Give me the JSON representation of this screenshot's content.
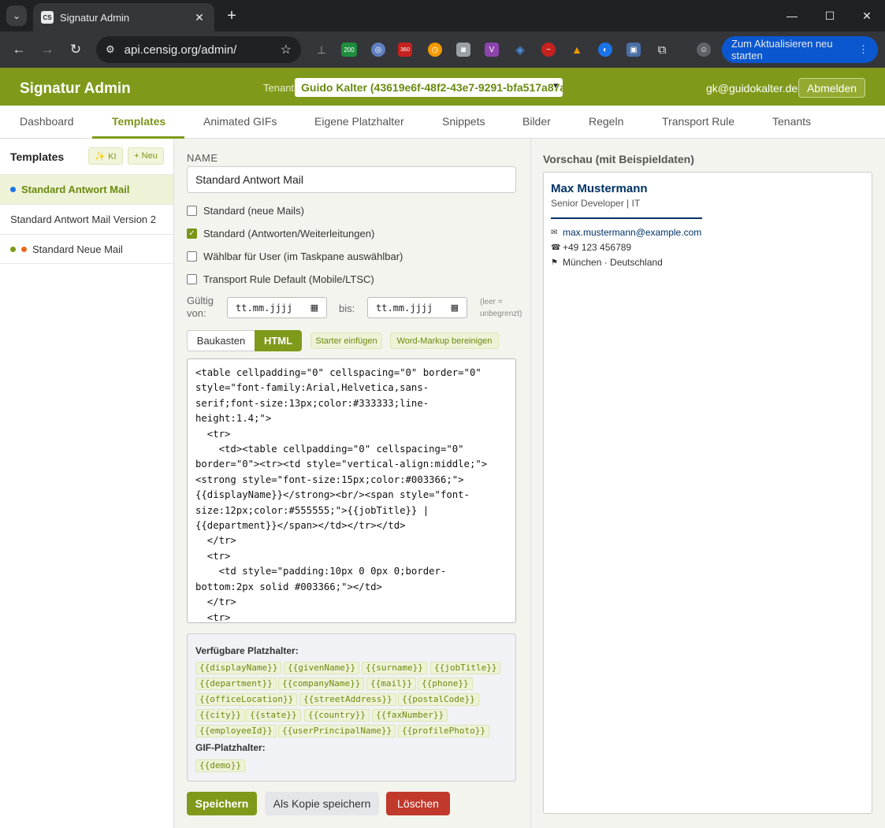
{
  "browser": {
    "tab_title": "Signatur Admin",
    "favicon": "CS",
    "url": "api.censig.org/admin/",
    "update_button": "Zum Aktualisieren neu starten",
    "extension_badge_1": "200",
    "extension_badge_2": "360"
  },
  "header": {
    "title": "Signatur Admin",
    "tenant_label": "Tenant",
    "tenant_value": "Guido Kalter (43619e6f-48f2-43e7-9291-bfa517a87ae",
    "user_email": "gk@guidokalter.de",
    "logout": "Abmelden",
    "accent_color": "#7f9a1a"
  },
  "nav": {
    "tabs": [
      "Dashboard",
      "Templates",
      "Animated GIFs",
      "Eigene Platzhalter",
      "Snippets",
      "Bilder",
      "Regeln",
      "Transport Rule",
      "Tenants"
    ],
    "active": "Templates"
  },
  "sidebar": {
    "title": "Templates",
    "ki_button": "✨ KI",
    "new_button": "+ Neu",
    "items": [
      {
        "label": "Standard Antwort Mail",
        "active": true
      },
      {
        "label": "Standard Antwort Mail Version 2",
        "active": false
      },
      {
        "label": "Standard Neue Mail",
        "active": false
      }
    ]
  },
  "editor": {
    "name_label": "NAME",
    "name_value": "Standard Antwort Mail",
    "checkboxes": [
      {
        "label": "Standard (neue Mails)",
        "checked": false
      },
      {
        "label": "Standard (Antworten/Weiterleitungen)",
        "checked": true
      },
      {
        "label": "Wählbar für User (im Taskpane auswählbar)",
        "checked": false
      },
      {
        "label": "Transport Rule Default (Mobile/LTSC)",
        "checked": false
      }
    ],
    "valid_from_label": "Gültig von:",
    "valid_to_label": "bis:",
    "date_placeholder": "tt.mm.jjjj",
    "hint": "(leer = unbegrenzt)",
    "mode_builder": "Baukasten",
    "mode_html": "HTML",
    "starter_button": "Starter einfügen",
    "clean_button": "Word-Markup bereinigen",
    "code": "<table cellpadding=\"0\" cellspacing=\"0\" border=\"0\"\nstyle=\"font-family:Arial,Helvetica,sans-\nserif;font-size:13px;color:#333333;line-\nheight:1.4;\">\n  <tr>\n    <td><table cellpadding=\"0\" cellspacing=\"0\"\nborder=\"0\"><tr><td style=\"vertical-align:middle;\">\n<strong style=\"font-size:15px;color:#003366;\">\n{{displayName}}</strong><br/><span style=\"font-\nsize:12px;color:#555555;\">{{jobTitle}} |\n{{department}}</span></td></tr></td>\n  </tr>\n  <tr>\n    <td style=\"padding:10px 0 0px 0;border-\nbottom:2px solid #003366;\"></td>\n  </tr>\n  <tr>",
    "placeholders_title": "Verfügbare Platzhalter:",
    "placeholders": [
      "{{displayName}}",
      "{{givenName}}",
      "{{surname}}",
      "{{jobTitle}}",
      "{{department}}",
      "{{companyName}}",
      "{{mail}}",
      "{{phone}}",
      "{{officeLocation}}",
      "{{streetAddress}}",
      "{{postalCode}}",
      "{{city}}",
      "{{state}}",
      "{{country}}",
      "{{faxNumber}}",
      "{{employeeId}}",
      "{{userPrincipalName}}",
      "{{profilePhoto}}"
    ],
    "gif_title": "GIF-Platzhalter:",
    "gif_placeholders": [
      "{{demo}}"
    ],
    "save": "Speichern",
    "save_copy": "Als Kopie speichern",
    "delete": "Löschen"
  },
  "preview": {
    "title": "Vorschau (mit Beispieldaten)",
    "name": "Max Mustermann",
    "subtitle": "Senior Developer | IT",
    "email": "max.mustermann@example.com",
    "phone": "+49 123 456789",
    "location": "München · Deutschland"
  }
}
